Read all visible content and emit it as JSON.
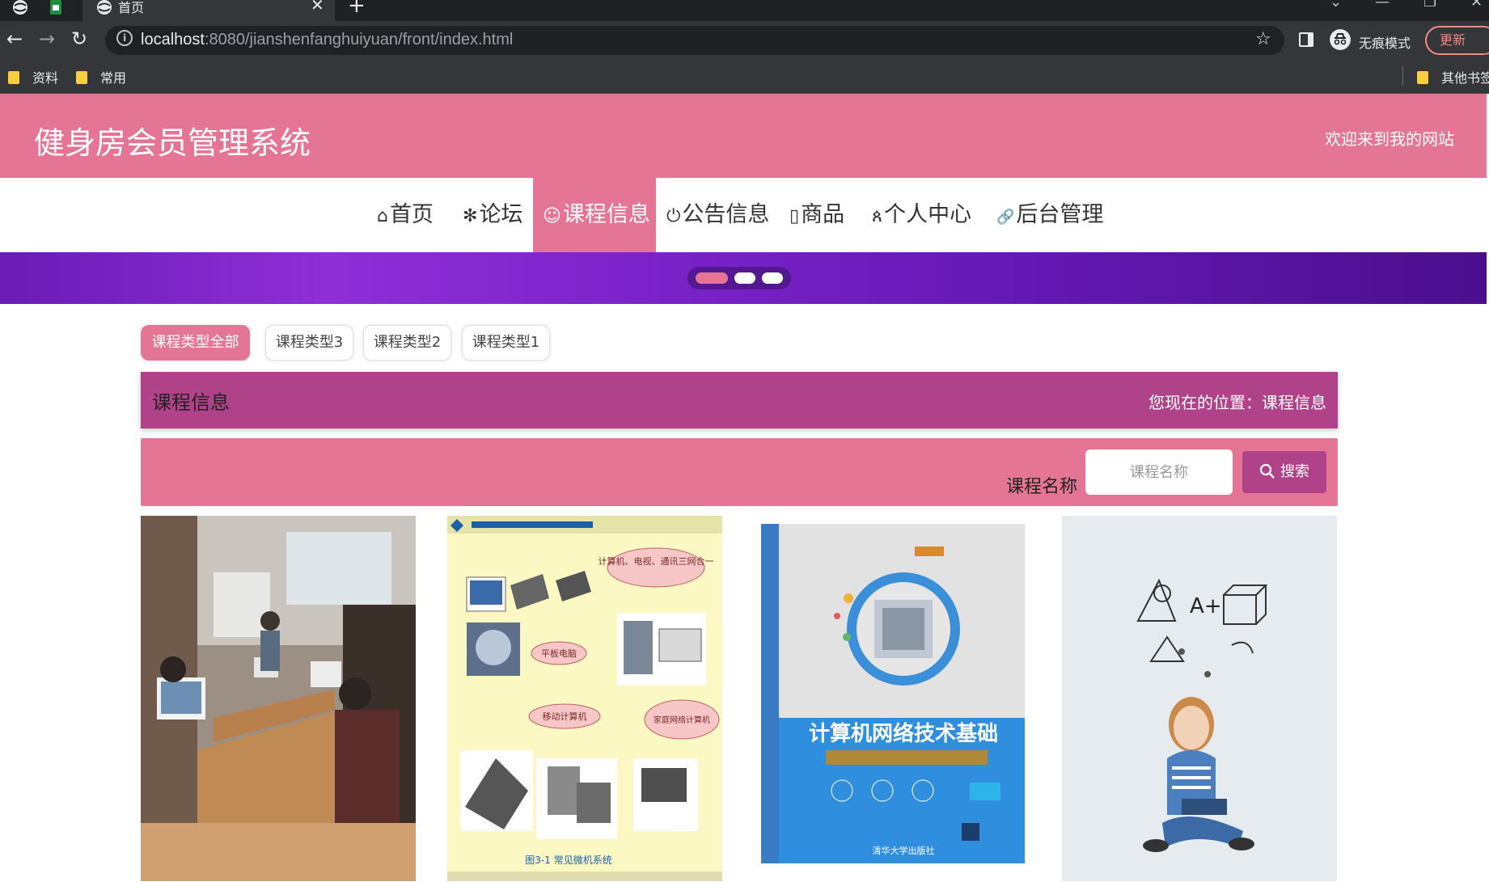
{
  "browser": {
    "tab_title": "首页",
    "url_host": "localhost",
    "url_path": ":8080/jianshenfanghuiyuan/front/index.html",
    "incognito_label": "无痕模式",
    "update_label": "更新",
    "bookmarks": [
      "资料",
      "常用"
    ],
    "other_bookmarks": "其他书签"
  },
  "header": {
    "site_title": "健身房会员管理系统",
    "welcome": "欢迎来到我的网站"
  },
  "nav": {
    "items": [
      {
        "icon": "home-icon",
        "glyph": "⌂",
        "label": "首页"
      },
      {
        "icon": "forum-icon",
        "glyph": "✻",
        "label": "论坛"
      },
      {
        "icon": "course-icon",
        "glyph": "☺",
        "label": "课程信息",
        "active": true
      },
      {
        "icon": "power-icon",
        "glyph": "⏻",
        "label": "公告信息"
      },
      {
        "icon": "product-icon",
        "glyph": "▯",
        "label": "商品"
      },
      {
        "icon": "user-icon",
        "glyph": "ጰ",
        "label": "个人中心"
      },
      {
        "icon": "link-icon",
        "glyph": "🔗",
        "label": "后台管理"
      }
    ]
  },
  "banner": {
    "slide_count": 3,
    "active_slide": 1
  },
  "filters": [
    "课程类型全部",
    "课程类型3",
    "课程类型2",
    "课程类型1"
  ],
  "section": {
    "title": "课程信息",
    "breadcrumb": "您现在的位置：课程信息"
  },
  "search": {
    "label": "课程名称",
    "placeholder": "课程名称",
    "button_label": "搜索",
    "icon": "search-icon"
  },
  "course_cards": [
    {
      "image": "classroom-photo"
    },
    {
      "image": "computer-types-diagram",
      "bubble_texts": [
        "计算机、电视、通讯三网合一",
        "平板电脑",
        "移动计算机",
        "家庭网络计算机"
      ],
      "caption": "图3-1 常见微机系统"
    },
    {
      "image": "network-textbook-cover",
      "cover_title": "计算机网络技术基础",
      "publisher": "清华大学出版社"
    },
    {
      "image": "student-reading-photo",
      "formula": "A+"
    }
  ],
  "colors": {
    "primary": "#e57595",
    "accent": "#b0428a",
    "banner": "#7a22c9"
  }
}
